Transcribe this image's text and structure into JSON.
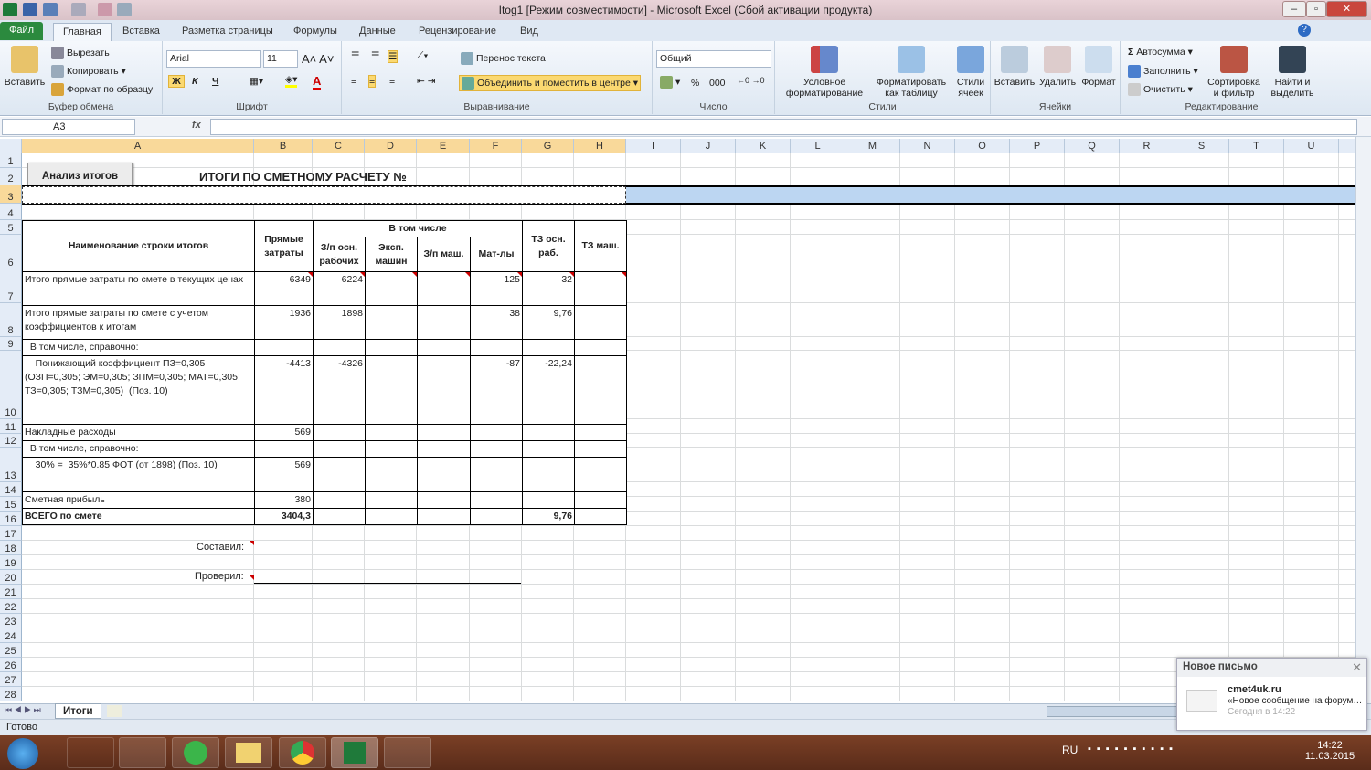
{
  "window": {
    "title": "Itog1  [Режим совместимости]  -  Microsoft Excel (Сбой активации продукта)"
  },
  "tabs": [
    "Файл",
    "Главная",
    "Вставка",
    "Разметка страницы",
    "Формулы",
    "Данные",
    "Рецензирование",
    "Вид"
  ],
  "ribbon": {
    "clipboard": {
      "paste": "Вставить",
      "cut": "Вырезать",
      "copy": "Копировать",
      "format_painter": "Формат по образцу",
      "label": "Буфер обмена"
    },
    "font": {
      "name": "Arial",
      "size": "11",
      "bold": "Ж",
      "italic": "К",
      "underline": "Ч",
      "label": "Шрифт"
    },
    "alignment": {
      "wrap": "Перенос текста",
      "merge": "Объединить и поместить в центре",
      "label": "Выравнивание"
    },
    "number": {
      "format": "Общий",
      "percent": "%",
      "thousands": "000",
      "label": "Число"
    },
    "styles": {
      "conditional": "Условное форматирование",
      "as_table": "Форматировать как таблицу",
      "cell_styles": "Стили ячеек",
      "label": "Стили"
    },
    "cells": {
      "insert": "Вставить",
      "delete": "Удалить",
      "format": "Формат",
      "label": "Ячейки"
    },
    "editing": {
      "autosum": "Автосумма",
      "fill": "Заполнить",
      "clear": "Очистить",
      "sort": "Сортировка и фильтр",
      "find": "Найти и выделить",
      "label": "Редактирование"
    }
  },
  "formula_bar": {
    "name_box": "A3",
    "fx": "fx",
    "value": ""
  },
  "columns": [
    "A",
    "B",
    "C",
    "D",
    "E",
    "F",
    "G",
    "H",
    "I",
    "J",
    "K",
    "L",
    "M",
    "N",
    "O",
    "P",
    "Q",
    "R",
    "S",
    "T",
    "U"
  ],
  "rows": [
    "1",
    "2",
    "3",
    "4",
    "5",
    "6",
    "7",
    "8",
    "9",
    "10",
    "11",
    "12",
    "13",
    "14",
    "15",
    "16",
    "17",
    "18",
    "19",
    "20",
    "21",
    "22",
    "23",
    "24",
    "25",
    "26",
    "27",
    "28"
  ],
  "sheet": {
    "button": "Анализ итогов",
    "title": "ИТОГИ ПО СМЕТНОМУ РАСЧЕТУ №",
    "headers": {
      "name": "Наименование строки итогов",
      "direct": "Прямые затраты",
      "incl": "В том числе",
      "zp": "З/п осн. рабочих",
      "exp": "Эксп. машин",
      "zpm": "З/п маш.",
      "mat": "Мат-лы",
      "tz": "ТЗ осн. раб.",
      "tzm": "ТЗ маш."
    },
    "table_rows": [
      {
        "name": "Итого прямые затраты по смете в текущих ценах",
        "direct": "6349",
        "zp": "6224",
        "exp": "",
        "zpm": "",
        "mat": "125",
        "tz": "32",
        "tzm": ""
      },
      {
        "name": "Итого прямые затраты по смете с учетом коэффициентов к итогам",
        "direct": "1936",
        "zp": "1898",
        "exp": "",
        "zpm": "",
        "mat": "38",
        "tz": "9,76",
        "tzm": ""
      },
      {
        "name": "  В том числе, справочно:",
        "direct": "",
        "zp": "",
        "exp": "",
        "zpm": "",
        "mat": "",
        "tz": "",
        "tzm": ""
      },
      {
        "name": "    Понижающий коэффициент ПЗ=0,305 (ОЗП=0,305; ЭМ=0,305; ЗПМ=0,305; МАТ=0,305; ТЗ=0,305; ТЗМ=0,305)  (Поз. 10)",
        "direct": "-4413",
        "zp": "-4326",
        "exp": "",
        "zpm": "",
        "mat": "-87",
        "tz": "-22,24",
        "tzm": ""
      },
      {
        "name": "Накладные расходы",
        "direct": "569",
        "zp": "",
        "exp": "",
        "zpm": "",
        "mat": "",
        "tz": "",
        "tzm": ""
      },
      {
        "name": "  В том числе, справочно:",
        "direct": "",
        "zp": "",
        "exp": "",
        "zpm": "",
        "mat": "",
        "tz": "",
        "tzm": ""
      },
      {
        "name": "    30% =  35%*0.85 ФОТ (от 1898) (Поз. 10)",
        "direct": "569",
        "zp": "",
        "exp": "",
        "zpm": "",
        "mat": "",
        "tz": "",
        "tzm": ""
      },
      {
        "name": "Сметная прибыль",
        "direct": "380",
        "zp": "",
        "exp": "",
        "zpm": "",
        "mat": "",
        "tz": "",
        "tzm": ""
      },
      {
        "name": "ВСЕГО по смете",
        "direct": "3404,3",
        "zp": "",
        "exp": "",
        "zpm": "",
        "mat": "",
        "tz": "9,76",
        "tzm": ""
      }
    ],
    "compiled": "Составил:",
    "checked": "Проверил:"
  },
  "sheet_tabs": [
    "Итоги"
  ],
  "status": "Готово",
  "notification": {
    "title": "Новое письмо",
    "sender": "cmet4uk.ru",
    "message": "«Новое сообщение на форум…",
    "time": "Сегодня в 14:22"
  },
  "tray": {
    "lang": "RU",
    "time": "14:22",
    "date": "11.03.2015"
  }
}
